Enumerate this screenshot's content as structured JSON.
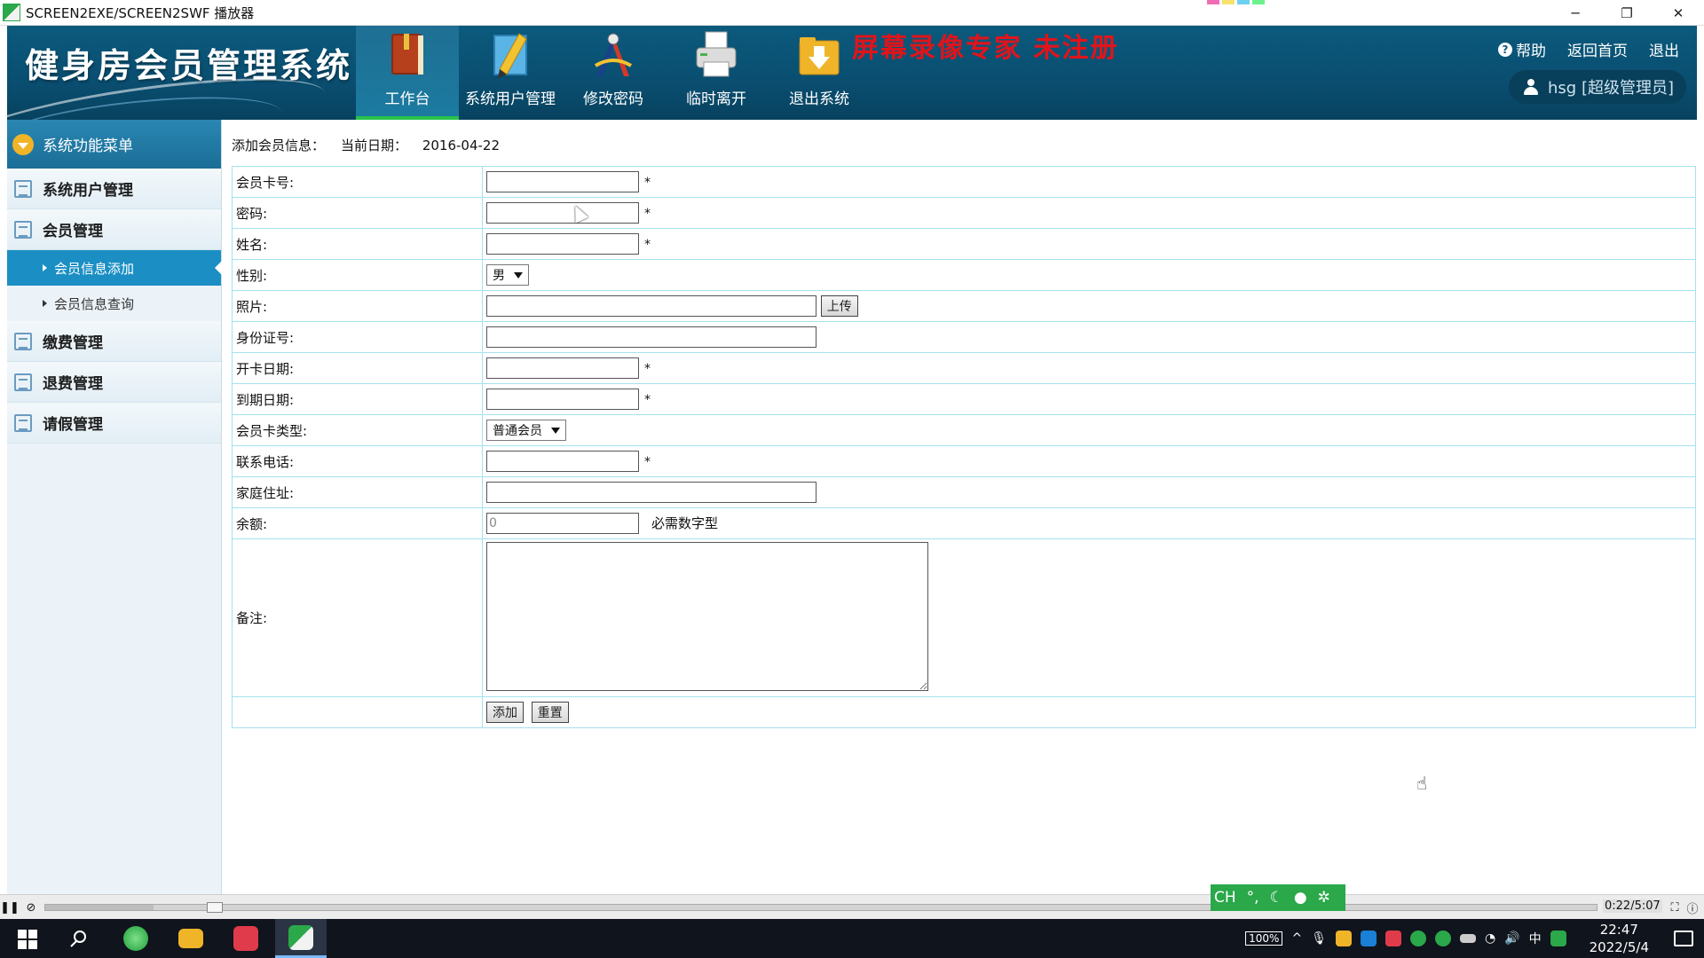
{
  "window": {
    "title": "SCREEN2EXE/SCREEN2SWF 播放器",
    "minimize": "─",
    "restore": "❐",
    "close": "✕"
  },
  "header": {
    "app_title": "健身房会员管理系统",
    "watermark": "屏幕录像专家  未注册",
    "nav": [
      {
        "label": "工作台",
        "icon": "book-icon",
        "active": true
      },
      {
        "label": "系统用户管理",
        "icon": "pencil-ruler-icon",
        "active": false
      },
      {
        "label": "修改密码",
        "icon": "compass-icon",
        "active": false
      },
      {
        "label": "临时离开",
        "icon": "printer-icon",
        "active": false
      },
      {
        "label": "退出系统",
        "icon": "exit-folder-icon",
        "active": false
      }
    ],
    "links": {
      "help": "帮助",
      "home": "返回首页",
      "logout": "退出"
    },
    "user": "hsg [超级管理员]"
  },
  "sidebar": {
    "title": "系统功能菜单",
    "items": [
      {
        "label": "系统用户管理"
      },
      {
        "label": "会员管理",
        "children": [
          {
            "label": "会员信息添加",
            "active": true
          },
          {
            "label": "会员信息查询",
            "active": false
          }
        ]
      },
      {
        "label": "缴费管理"
      },
      {
        "label": "退费管理"
      },
      {
        "label": "请假管理"
      }
    ]
  },
  "form": {
    "crumb_label": "添加会员信息：",
    "date_label": "当前日期：",
    "date_value": "2016-04-22",
    "card_no_label": "会员卡号:",
    "password_label": "密码:",
    "name_label": "姓名:",
    "gender_label": "性别:",
    "gender_value": "男",
    "photo_label": "照片:",
    "upload_button": "上传",
    "id_no_label": "身份证号:",
    "start_date_label": "开卡日期:",
    "end_date_label": "到期日期:",
    "card_type_label": "会员卡类型:",
    "card_type_value": "普通会员",
    "phone_label": "联系电话:",
    "address_label": "家庭住址:",
    "balance_label": "余额:",
    "balance_value": "0",
    "balance_hint": "必需数字型",
    "remark_label": "备注:",
    "add_button": "添加",
    "reset_button": "重置",
    "required_mark": "*"
  },
  "player": {
    "time": "0:22/5:07",
    "progress": 0.07
  },
  "ime": {
    "lang": "CH",
    "punct": "°,",
    "mode": "☾"
  },
  "taskbar": {
    "battery": "100%",
    "input_lang": "中",
    "time": "22:47",
    "date": "2022/5/4"
  },
  "colors": {
    "header_bg": "#0b5a7d",
    "nav_active_underline": "#26c24b",
    "sidebar_active": "#1b8fc4",
    "watermark": "#e0141b",
    "table_border": "#a5e2ee"
  }
}
